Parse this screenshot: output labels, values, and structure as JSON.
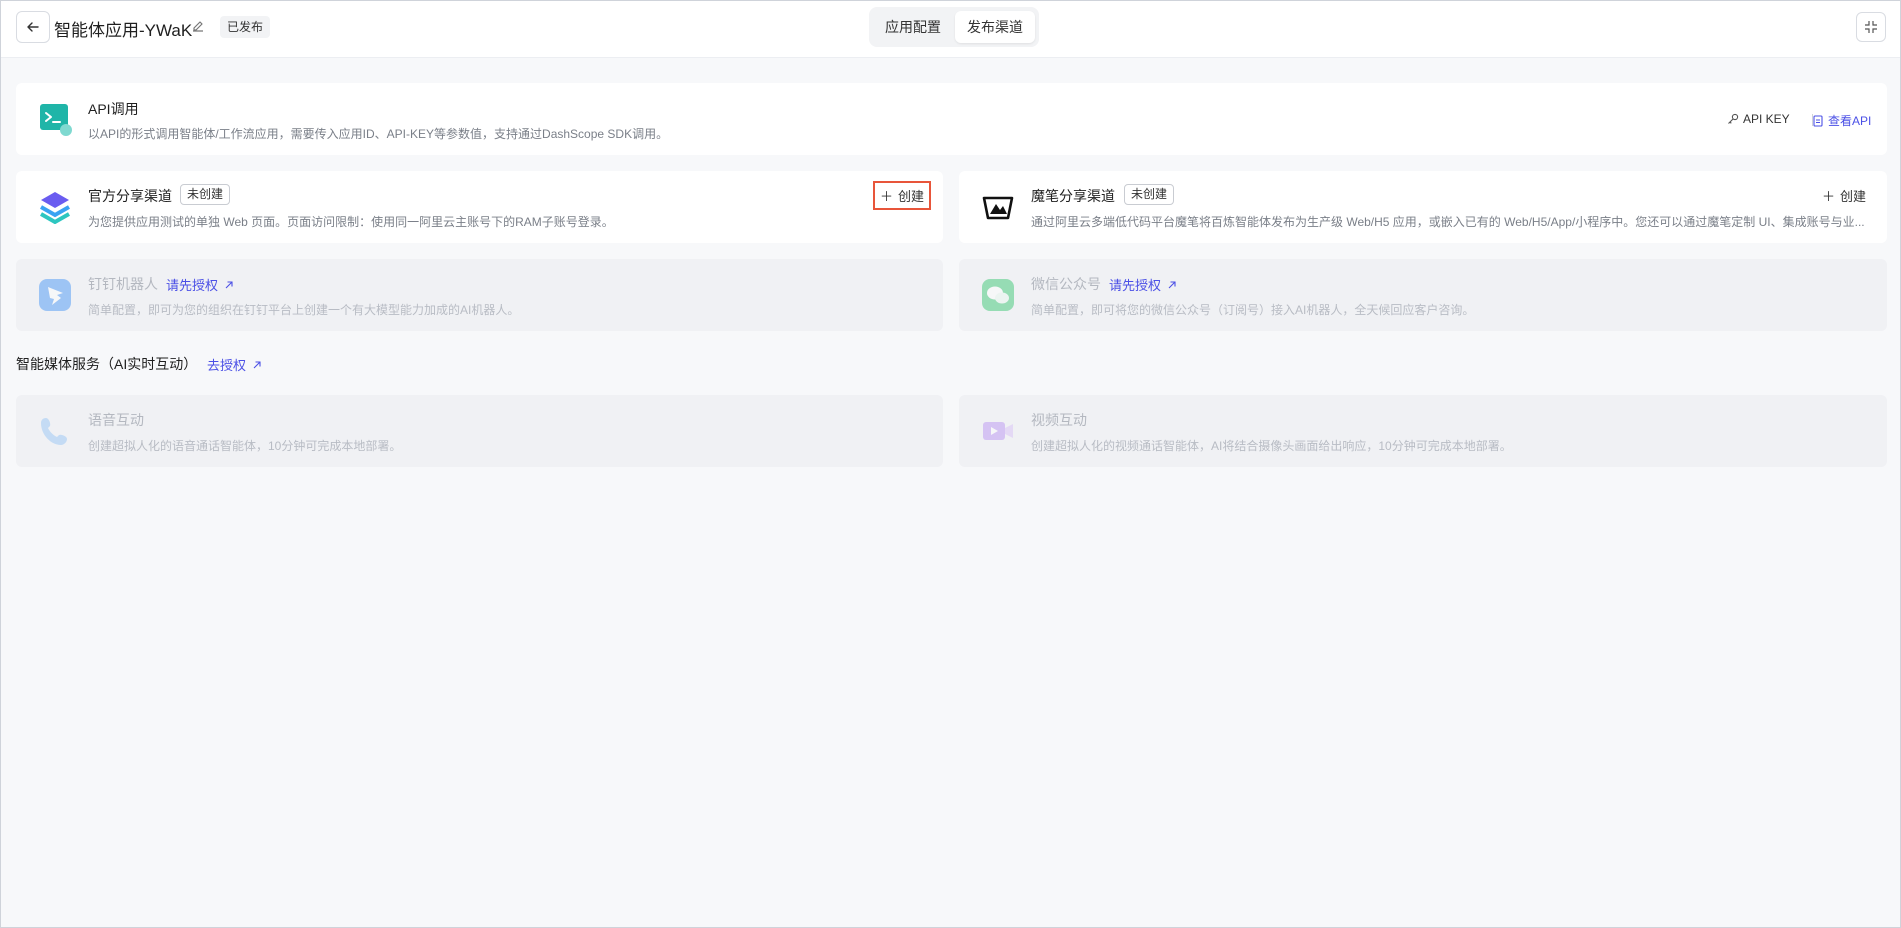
{
  "header": {
    "back_icon": "arrow-left-icon",
    "app_title": "智能体应用-YWaK",
    "status_badge": "已发布",
    "tabs": [
      {
        "label": "应用配置",
        "active": false
      },
      {
        "label": "发布渠道",
        "active": true
      }
    ]
  },
  "api_card": {
    "title": "API调用",
    "description": "以API的形式调用智能体/工作流应用，需要传入应用ID、API-KEY等参数值，支持通过DashScope SDK调用。",
    "api_key_label": "API KEY",
    "view_api_label": "查看API"
  },
  "official_share": {
    "title": "官方分享渠道",
    "status": "未创建",
    "description": "为您提供应用测试的单独 Web 页面。页面访问限制：使用同一阿里云主账号下的RAM子账号登录。",
    "create_label": "创建"
  },
  "mobi_share": {
    "title": "魔笔分享渠道",
    "status": "未创建",
    "description": "通过阿里云多端低代码平台魔笔将百炼智能体发布为生产级 Web/H5 应用，或嵌入已有的 Web/H5/App/小程序中。您还可以通过魔笔定制 UI、集成账号与业...",
    "create_label": "创建"
  },
  "dingtalk": {
    "title": "钉钉机器人",
    "auth_label": "请先授权",
    "description": "简单配置，即可为您的组织在钉钉平台上创建一个有大模型能力加成的AI机器人。"
  },
  "wechat": {
    "title": "微信公众号",
    "auth_label": "请先授权",
    "description": "简单配置，即可将您的微信公众号（订阅号）接入AI机器人，全天候回应客户咨询。"
  },
  "media_section": {
    "title": "智能媒体服务（AI实时互动）",
    "auth_label": "去授权"
  },
  "voice": {
    "title": "语音互动",
    "description": "创建超拟人化的语音通话智能体，10分钟可完成本地部署。"
  },
  "video": {
    "title": "视频互动",
    "description": "创建超拟人化的视频通话智能体，AI将结合摄像头画面给出响应，10分钟可完成本地部署。"
  },
  "colors": {
    "accent": "#4b50e6",
    "highlight_border": "#e8553a",
    "background": "#f7f8fa"
  }
}
